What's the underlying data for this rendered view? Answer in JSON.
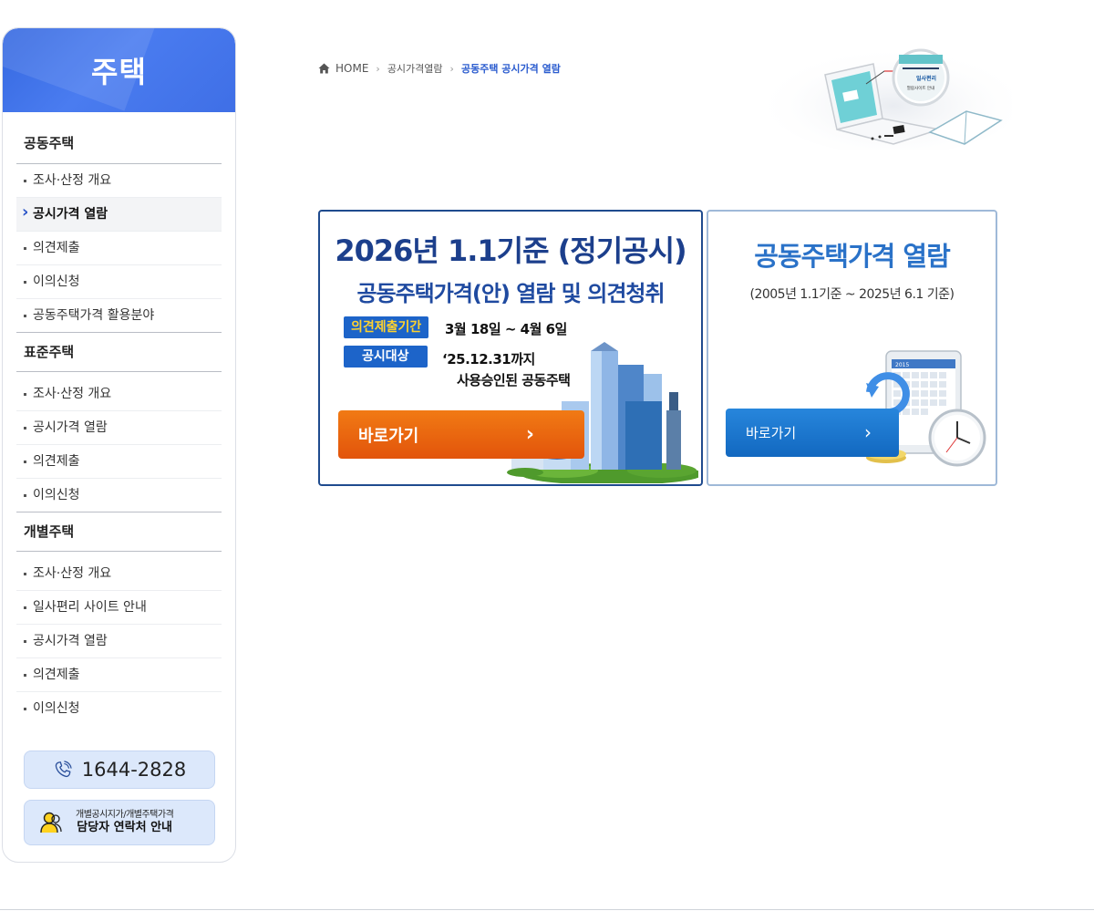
{
  "sidebar": {
    "title": "주택",
    "sections": [
      {
        "title": "공동주택",
        "items": [
          "조사·산정 개요",
          "공시가격 열람",
          "의견제출",
          "이의신청",
          "공동주택가격 활용분야"
        ]
      },
      {
        "title": "표준주택",
        "items": [
          "조사·산정 개요",
          "공시가격 열람",
          "의견제출",
          "이의신청"
        ]
      },
      {
        "title": "개별주택",
        "items": [
          "조사·산정 개요",
          "일사편리 사이트 안내",
          "공시가격 열람",
          "의견제출",
          "이의신청"
        ]
      }
    ],
    "active_item": "공시가격 열람",
    "phone": "1644-2828",
    "phone_icon": "phone-icon",
    "contact": {
      "line1": "개별공시지가/개별주택가격",
      "line2": "담당자 연락처 안내",
      "icon": "person-icon"
    }
  },
  "breadcrumb": {
    "home": "HOME",
    "level1": "공시가격열람",
    "current": "공동주택 공시가격 열람"
  },
  "header_art": {
    "screen_text_top": "일사편리",
    "screen_text_bottom": "열람사이트 안내"
  },
  "banner_left": {
    "title": "2026년 1.1기준 (정기공시)",
    "subtitle": "공동주택가격(안) 열람 및 의견청취",
    "period_label": "의견제출기간",
    "period_value": "3월 18일 ~ 4월 6일",
    "target_label": "공시대상",
    "target_value_line1": "‘25.12.31까지",
    "target_value_line2": "사용승인된 공동주택",
    "button": "바로가기"
  },
  "banner_right": {
    "title": "공동주택가격 열람",
    "subtitle": "(2005년 1.1기준 ~ 2025년 6.1 기준)",
    "button": "바로가기",
    "calendar_year": "2015"
  },
  "colors": {
    "primary_blue": "#3568e0",
    "banner_navy": "#1c3f8c",
    "orange_button": "#e2540b",
    "blue_button": "#1268c0"
  }
}
